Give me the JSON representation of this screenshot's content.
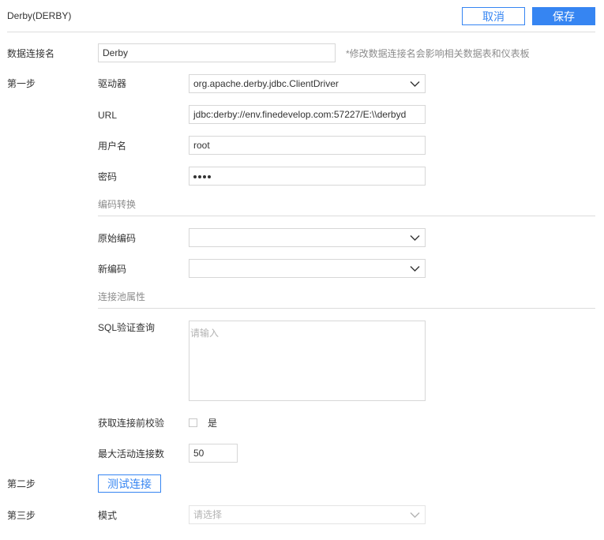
{
  "header": {
    "title": "Derby(DERBY)",
    "cancel_label": "取消",
    "save_label": "保存"
  },
  "connection_name": {
    "label": "数据连接名",
    "value": "Derby",
    "hint": "*修改数据连接名会影响相关数据表和仪表板"
  },
  "step1": {
    "label": "第一步",
    "driver": {
      "label": "驱动器",
      "value": "org.apache.derby.jdbc.ClientDriver"
    },
    "url": {
      "label": "URL",
      "value": "jdbc:derby://env.finedevelop.com:57227/E:\\\\derbyd"
    },
    "username": {
      "label": "用户名",
      "value": "root"
    },
    "password": {
      "label": "密码",
      "masked_length": 4
    },
    "encoding_section": "编码转换",
    "original_encoding": {
      "label": "原始编码",
      "value": ""
    },
    "new_encoding": {
      "label": "新编码",
      "value": ""
    },
    "pool_section": "连接池属性",
    "sql_validation": {
      "label": "SQL验证查询",
      "placeholder": "请输入"
    },
    "validate_before": {
      "label": "获取连接前校验",
      "option_label": "是",
      "checked": false
    },
    "max_active": {
      "label": "最大活动连接数",
      "value": "50"
    }
  },
  "step2": {
    "label": "第二步",
    "test_button_label": "测试连接"
  },
  "step3": {
    "label": "第三步",
    "mode": {
      "label": "模式",
      "placeholder": "请选择"
    }
  },
  "icons": {
    "dropdown": "chevron-down-icon",
    "dropdown_color": "#333333",
    "dropdown_disabled_color": "#b3b3b3"
  },
  "colors": {
    "accent": "#3685f2",
    "border": "#d7d7d7",
    "divider": "#dcdcdc"
  }
}
